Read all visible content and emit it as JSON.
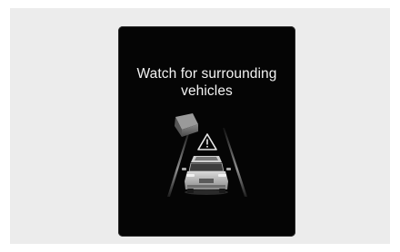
{
  "warning": {
    "line1": "Watch for surrounding",
    "line2": "vehicles"
  },
  "icons": {
    "warning_symbol": "warning-triangle-icon",
    "vehicle": "own-vehicle-rear-icon",
    "adjacent_vehicle": "surrounding-vehicle-icon"
  },
  "colors": {
    "background": "#ececec",
    "screen": "#050505",
    "text": "#f2f2f2",
    "adjacent_vehicle": "#6b6b6b"
  }
}
